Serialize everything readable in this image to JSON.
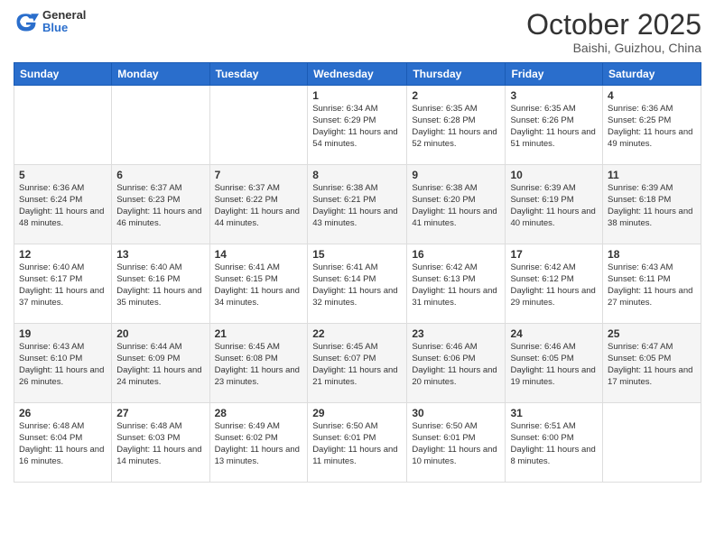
{
  "header": {
    "logo_general": "General",
    "logo_blue": "Blue",
    "month_title": "October 2025",
    "location": "Baishi, Guizhou, China"
  },
  "days_of_week": [
    "Sunday",
    "Monday",
    "Tuesday",
    "Wednesday",
    "Thursday",
    "Friday",
    "Saturday"
  ],
  "weeks": [
    [
      {
        "day": "",
        "sunrise": "",
        "sunset": "",
        "daylight": ""
      },
      {
        "day": "",
        "sunrise": "",
        "sunset": "",
        "daylight": ""
      },
      {
        "day": "",
        "sunrise": "",
        "sunset": "",
        "daylight": ""
      },
      {
        "day": "1",
        "sunrise": "Sunrise: 6:34 AM",
        "sunset": "Sunset: 6:29 PM",
        "daylight": "Daylight: 11 hours and 54 minutes."
      },
      {
        "day": "2",
        "sunrise": "Sunrise: 6:35 AM",
        "sunset": "Sunset: 6:28 PM",
        "daylight": "Daylight: 11 hours and 52 minutes."
      },
      {
        "day": "3",
        "sunrise": "Sunrise: 6:35 AM",
        "sunset": "Sunset: 6:26 PM",
        "daylight": "Daylight: 11 hours and 51 minutes."
      },
      {
        "day": "4",
        "sunrise": "Sunrise: 6:36 AM",
        "sunset": "Sunset: 6:25 PM",
        "daylight": "Daylight: 11 hours and 49 minutes."
      }
    ],
    [
      {
        "day": "5",
        "sunrise": "Sunrise: 6:36 AM",
        "sunset": "Sunset: 6:24 PM",
        "daylight": "Daylight: 11 hours and 48 minutes."
      },
      {
        "day": "6",
        "sunrise": "Sunrise: 6:37 AM",
        "sunset": "Sunset: 6:23 PM",
        "daylight": "Daylight: 11 hours and 46 minutes."
      },
      {
        "day": "7",
        "sunrise": "Sunrise: 6:37 AM",
        "sunset": "Sunset: 6:22 PM",
        "daylight": "Daylight: 11 hours and 44 minutes."
      },
      {
        "day": "8",
        "sunrise": "Sunrise: 6:38 AM",
        "sunset": "Sunset: 6:21 PM",
        "daylight": "Daylight: 11 hours and 43 minutes."
      },
      {
        "day": "9",
        "sunrise": "Sunrise: 6:38 AM",
        "sunset": "Sunset: 6:20 PM",
        "daylight": "Daylight: 11 hours and 41 minutes."
      },
      {
        "day": "10",
        "sunrise": "Sunrise: 6:39 AM",
        "sunset": "Sunset: 6:19 PM",
        "daylight": "Daylight: 11 hours and 40 minutes."
      },
      {
        "day": "11",
        "sunrise": "Sunrise: 6:39 AM",
        "sunset": "Sunset: 6:18 PM",
        "daylight": "Daylight: 11 hours and 38 minutes."
      }
    ],
    [
      {
        "day": "12",
        "sunrise": "Sunrise: 6:40 AM",
        "sunset": "Sunset: 6:17 PM",
        "daylight": "Daylight: 11 hours and 37 minutes."
      },
      {
        "day": "13",
        "sunrise": "Sunrise: 6:40 AM",
        "sunset": "Sunset: 6:16 PM",
        "daylight": "Daylight: 11 hours and 35 minutes."
      },
      {
        "day": "14",
        "sunrise": "Sunrise: 6:41 AM",
        "sunset": "Sunset: 6:15 PM",
        "daylight": "Daylight: 11 hours and 34 minutes."
      },
      {
        "day": "15",
        "sunrise": "Sunrise: 6:41 AM",
        "sunset": "Sunset: 6:14 PM",
        "daylight": "Daylight: 11 hours and 32 minutes."
      },
      {
        "day": "16",
        "sunrise": "Sunrise: 6:42 AM",
        "sunset": "Sunset: 6:13 PM",
        "daylight": "Daylight: 11 hours and 31 minutes."
      },
      {
        "day": "17",
        "sunrise": "Sunrise: 6:42 AM",
        "sunset": "Sunset: 6:12 PM",
        "daylight": "Daylight: 11 hours and 29 minutes."
      },
      {
        "day": "18",
        "sunrise": "Sunrise: 6:43 AM",
        "sunset": "Sunset: 6:11 PM",
        "daylight": "Daylight: 11 hours and 27 minutes."
      }
    ],
    [
      {
        "day": "19",
        "sunrise": "Sunrise: 6:43 AM",
        "sunset": "Sunset: 6:10 PM",
        "daylight": "Daylight: 11 hours and 26 minutes."
      },
      {
        "day": "20",
        "sunrise": "Sunrise: 6:44 AM",
        "sunset": "Sunset: 6:09 PM",
        "daylight": "Daylight: 11 hours and 24 minutes."
      },
      {
        "day": "21",
        "sunrise": "Sunrise: 6:45 AM",
        "sunset": "Sunset: 6:08 PM",
        "daylight": "Daylight: 11 hours and 23 minutes."
      },
      {
        "day": "22",
        "sunrise": "Sunrise: 6:45 AM",
        "sunset": "Sunset: 6:07 PM",
        "daylight": "Daylight: 11 hours and 21 minutes."
      },
      {
        "day": "23",
        "sunrise": "Sunrise: 6:46 AM",
        "sunset": "Sunset: 6:06 PM",
        "daylight": "Daylight: 11 hours and 20 minutes."
      },
      {
        "day": "24",
        "sunrise": "Sunrise: 6:46 AM",
        "sunset": "Sunset: 6:05 PM",
        "daylight": "Daylight: 11 hours and 19 minutes."
      },
      {
        "day": "25",
        "sunrise": "Sunrise: 6:47 AM",
        "sunset": "Sunset: 6:05 PM",
        "daylight": "Daylight: 11 hours and 17 minutes."
      }
    ],
    [
      {
        "day": "26",
        "sunrise": "Sunrise: 6:48 AM",
        "sunset": "Sunset: 6:04 PM",
        "daylight": "Daylight: 11 hours and 16 minutes."
      },
      {
        "day": "27",
        "sunrise": "Sunrise: 6:48 AM",
        "sunset": "Sunset: 6:03 PM",
        "daylight": "Daylight: 11 hours and 14 minutes."
      },
      {
        "day": "28",
        "sunrise": "Sunrise: 6:49 AM",
        "sunset": "Sunset: 6:02 PM",
        "daylight": "Daylight: 11 hours and 13 minutes."
      },
      {
        "day": "29",
        "sunrise": "Sunrise: 6:50 AM",
        "sunset": "Sunset: 6:01 PM",
        "daylight": "Daylight: 11 hours and 11 minutes."
      },
      {
        "day": "30",
        "sunrise": "Sunrise: 6:50 AM",
        "sunset": "Sunset: 6:01 PM",
        "daylight": "Daylight: 11 hours and 10 minutes."
      },
      {
        "day": "31",
        "sunrise": "Sunrise: 6:51 AM",
        "sunset": "Sunset: 6:00 PM",
        "daylight": "Daylight: 11 hours and 8 minutes."
      },
      {
        "day": "",
        "sunrise": "",
        "sunset": "",
        "daylight": ""
      }
    ]
  ]
}
